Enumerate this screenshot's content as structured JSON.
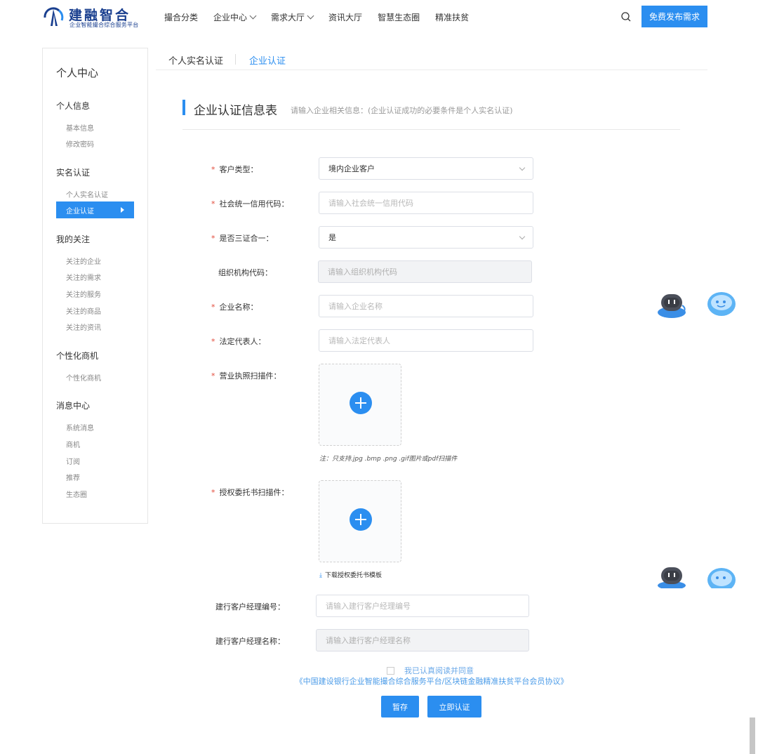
{
  "header": {
    "logo_title": "建融智合",
    "logo_subtitle": "企业智能撮合综合服务平台",
    "nav": [
      {
        "label": "撮合分类",
        "dropdown": false
      },
      {
        "label": "企业中心",
        "dropdown": true
      },
      {
        "label": "需求大厅",
        "dropdown": true
      },
      {
        "label": "资讯大厅",
        "dropdown": false
      },
      {
        "label": "智慧生态圈",
        "dropdown": false
      },
      {
        "label": "精准扶贫",
        "dropdown": false
      }
    ],
    "publish_button": "免费发布需求"
  },
  "sidebar": {
    "title": "个人中心",
    "groups": [
      {
        "label": "个人信息",
        "items": [
          "基本信息",
          "修改密码"
        ]
      },
      {
        "label": "实名认证",
        "items": [
          "个人实名认证",
          "企业认证"
        ]
      },
      {
        "label": "我的关注",
        "items": [
          "关注的企业",
          "关注的需求",
          "关注的服务",
          "关注的商品",
          "关注的资讯"
        ]
      },
      {
        "label": "个性化商机",
        "items": [
          "个性化商机"
        ]
      },
      {
        "label": "消息中心",
        "items": [
          "系统消息",
          "商机",
          "订阅",
          "推荐",
          "生态圈"
        ]
      }
    ],
    "active_item": "企业认证"
  },
  "tabs": [
    {
      "label": "个人实名认证",
      "active": false
    },
    {
      "label": "企业认证",
      "active": true
    }
  ],
  "section": {
    "title": "企业认证信息表",
    "hint": "请输入企业相关信息：(企业认证成功的必要条件是个人实名认证)"
  },
  "form": {
    "customer_type": {
      "label": "客户类型：",
      "value": "境内企业客户"
    },
    "credit_code": {
      "label": "社会统一信用代码：",
      "placeholder": "请输入社会统一信用代码"
    },
    "three_in_one": {
      "label": "是否三证合一：",
      "value": "是"
    },
    "org_code": {
      "label": "组织机构代码：",
      "placeholder": "请输入组织机构代码"
    },
    "company_name": {
      "label": "企业名称：",
      "placeholder": "请输入企业名称"
    },
    "legal_rep": {
      "label": "法定代表人：",
      "placeholder": "请输入法定代表人"
    },
    "license_scan": {
      "label": "营业执照扫描件：",
      "note": "注：只支持.jpg .bmp .png .gif图片或pdf扫描件"
    },
    "authorization_scan": {
      "label": "授权委托书扫描件：",
      "download": "下载授权委托书模板"
    },
    "manager_id": {
      "label": "建行客户经理编号：",
      "placeholder": "请输入建行客户经理编号"
    },
    "manager_name": {
      "label": "建行客户经理名称：",
      "placeholder": "请输入建行客户经理名称"
    }
  },
  "agreement": {
    "checkbox_label": "我已认真阅读并同意",
    "link": "《中国建设银行企业智能撮合综合服务平台/区块链金融精准扶贫平台会员协议》"
  },
  "actions": {
    "save": "暂存",
    "submit": "立即认证"
  },
  "colors": {
    "accent": "#2b8ef0",
    "required": "#e24b3b",
    "link": "#4a9be8",
    "brand": "#1a3f8f"
  }
}
